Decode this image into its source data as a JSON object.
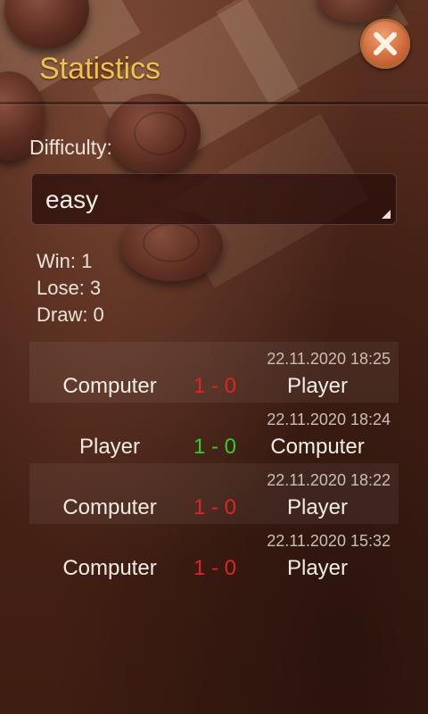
{
  "header": {
    "title": "Statistics"
  },
  "difficulty": {
    "label": "Difficulty:",
    "selected": "easy"
  },
  "stats": {
    "win": "Win: 1",
    "lose": "Lose: 3",
    "draw": "Draw: 0"
  },
  "games": [
    {
      "date": "22.11.2020 18:25",
      "left": "Computer",
      "score": "1 - 0",
      "right": "Player",
      "result": "loss"
    },
    {
      "date": "22.11.2020 18:24",
      "left": "Player",
      "score": "1 - 0",
      "right": "Computer",
      "result": "win"
    },
    {
      "date": "22.11.2020 18:22",
      "left": "Computer",
      "score": "1 - 0",
      "right": "Player",
      "result": "loss"
    },
    {
      "date": "22.11.2020 15:32",
      "left": "Computer",
      "score": "1 - 0",
      "right": "Player",
      "result": "loss"
    }
  ],
  "colors": {
    "title": "#f2c14a",
    "loss_score": "#e02424",
    "win_score": "#2bd12b",
    "close_button": "#d0683c"
  },
  "icons": {
    "close": "close-icon"
  }
}
